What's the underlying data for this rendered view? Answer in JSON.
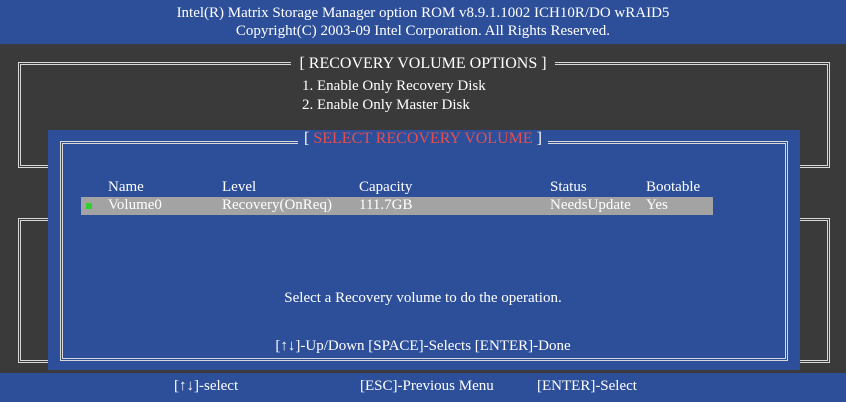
{
  "header": {
    "line1": "Intel(R) Matrix Storage Manager option ROM v8.9.1.1002 ICH10R/DO wRAID5",
    "line2": "Copyright(C) 2003-09 Intel Corporation.  All Rights Reserved."
  },
  "options_panel": {
    "title": "[ RECOVERY VOLUME OPTIONS ]",
    "items": [
      "1. Enable Only Recovery Disk",
      "2. Enable Only Master Disk"
    ]
  },
  "dialog": {
    "title_open": "[ ",
    "title": "SELECT RECOVERY VOLUME",
    "title_close": " ]",
    "columns": [
      "Name",
      "Level",
      "Capacity",
      "Status",
      "Bootable"
    ],
    "rows": [
      {
        "name": "Volume0",
        "level": "Recovery(OnReq)",
        "capacity": "111.7GB",
        "status": "NeedsUpdate",
        "bootable": "Yes",
        "selected": true
      }
    ],
    "message": "Select a Recovery volume to do the operation.",
    "help": "[↑↓]-Up/Down  [SPACE]-Selects  [ENTER]-Done"
  },
  "footer": {
    "select": "[↑↓]-select",
    "previous": "[ESC]-Previous Menu",
    "enter": "[ENTER]-Select"
  },
  "colors": {
    "panel_blue": "#2d4f9a",
    "background": "#3a3a3a",
    "title_red": "#e05050",
    "highlight": "#a3a3a3",
    "indicator": "#2fd02f"
  }
}
